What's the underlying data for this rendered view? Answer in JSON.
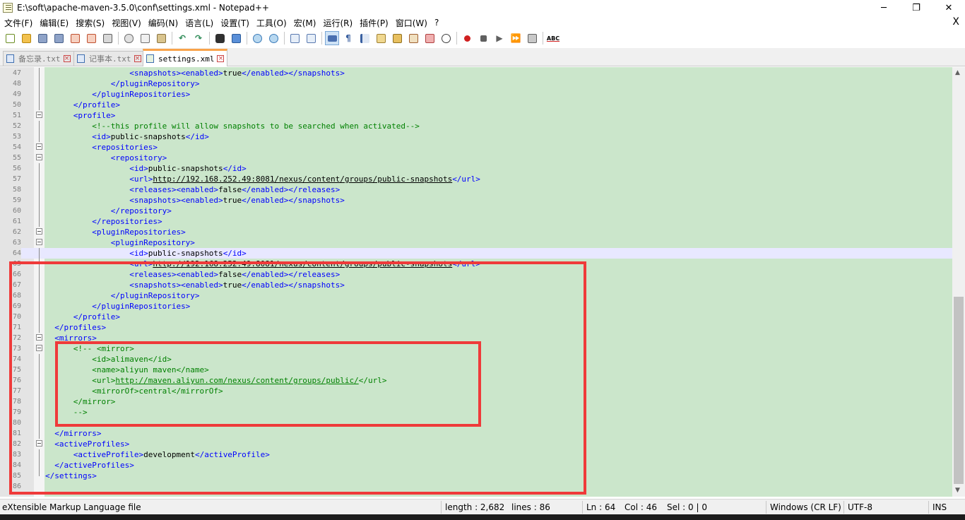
{
  "window": {
    "title": "E:\\soft\\apache-maven-3.5.0\\conf\\settings.xml - Notepad++",
    "minimize": "─",
    "restore": "❐",
    "close": "✕"
  },
  "menu": {
    "items": [
      "文件(F)",
      "编辑(E)",
      "搜索(S)",
      "视图(V)",
      "编码(N)",
      "语言(L)",
      "设置(T)",
      "工具(O)",
      "宏(M)",
      "运行(R)",
      "插件(P)",
      "窗口(W)",
      "?"
    ],
    "close_doc": "X"
  },
  "toolbar": {
    "spell_label": "ABC"
  },
  "tabs": [
    {
      "label": "备忘录.txt",
      "active": false
    },
    {
      "label": "记事本.txt",
      "active": false
    },
    {
      "label": "settings.xml",
      "active": true
    }
  ],
  "editor": {
    "current_line": 64,
    "lines": [
      {
        "n": "47",
        "fold": "line",
        "html": "                  <span class=\"tag\">&lt;snapshots&gt;&lt;enabled&gt;</span>true<span class=\"tag\">&lt;/enabled&gt;&lt;/snapshots&gt;</span>"
      },
      {
        "n": "48",
        "fold": "line",
        "html": "              <span class=\"tag\">&lt;/pluginRepository&gt;</span>"
      },
      {
        "n": "49",
        "fold": "line",
        "html": "          <span class=\"tag\">&lt;/pluginRepositories&gt;</span>"
      },
      {
        "n": "50",
        "fold": "line",
        "html": "      <span class=\"tag\">&lt;/profile&gt;</span>"
      },
      {
        "n": "51",
        "fold": "box",
        "html": "      <span class=\"tag\">&lt;profile&gt;</span>"
      },
      {
        "n": "52",
        "fold": "line",
        "html": "          <span class=\"cmt\">&lt;!--this profile will allow snapshots to be searched when activated--&gt;</span>"
      },
      {
        "n": "53",
        "fold": "line",
        "html": "          <span class=\"tag\">&lt;id&gt;</span>public-snapshots<span class=\"tag\">&lt;/id&gt;</span>"
      },
      {
        "n": "54",
        "fold": "box",
        "html": "          <span class=\"tag\">&lt;repositories&gt;</span>"
      },
      {
        "n": "55",
        "fold": "box",
        "html": "              <span class=\"tag\">&lt;repository&gt;</span>"
      },
      {
        "n": "56",
        "fold": "line",
        "html": "                  <span class=\"tag\">&lt;id&gt;</span>public-snapshots<span class=\"tag\">&lt;/id&gt;</span>"
      },
      {
        "n": "57",
        "fold": "line",
        "html": "                  <span class=\"tag\">&lt;url&gt;</span><span class=\"url\">http://192.168.252.49:8081/nexus/content/groups/public-snapshots</span><span class=\"tag\">&lt;/url&gt;</span>"
      },
      {
        "n": "58",
        "fold": "line",
        "html": "                  <span class=\"tag\">&lt;releases&gt;&lt;enabled&gt;</span>false<span class=\"tag\">&lt;/enabled&gt;&lt;/releases&gt;</span>"
      },
      {
        "n": "59",
        "fold": "line",
        "html": "                  <span class=\"tag\">&lt;snapshots&gt;&lt;enabled&gt;</span>true<span class=\"tag\">&lt;/enabled&gt;&lt;/snapshots&gt;</span>"
      },
      {
        "n": "60",
        "fold": "line",
        "html": "              <span class=\"tag\">&lt;/repository&gt;</span>"
      },
      {
        "n": "61",
        "fold": "line",
        "html": "          <span class=\"tag\">&lt;/repositories&gt;</span>"
      },
      {
        "n": "62",
        "fold": "box",
        "html": "          <span class=\"tag\">&lt;pluginRepositories&gt;</span>"
      },
      {
        "n": "63",
        "fold": "box",
        "html": "              <span class=\"tag\">&lt;pluginRepository&gt;</span>"
      },
      {
        "n": "64",
        "fold": "line",
        "html": "                  <span class=\"tag\">&lt;id&gt;</span>public-snapshots<span class=\"tag\">&lt;/id&gt;</span>"
      },
      {
        "n": "65",
        "fold": "line",
        "html": "                  <span class=\"tag\">&lt;url&gt;</span><span class=\"url\">http://192.168.252.49:8081/nexus/content/groups/public-snapshots</span><span class=\"tag\">&lt;/url&gt;</span>"
      },
      {
        "n": "66",
        "fold": "line",
        "html": "                  <span class=\"tag\">&lt;releases&gt;&lt;enabled&gt;</span>false<span class=\"tag\">&lt;/enabled&gt;&lt;/releases&gt;</span>"
      },
      {
        "n": "67",
        "fold": "line",
        "html": "                  <span class=\"tag\">&lt;snapshots&gt;&lt;enabled&gt;</span>true<span class=\"tag\">&lt;/enabled&gt;&lt;/snapshots&gt;</span>"
      },
      {
        "n": "68",
        "fold": "line",
        "html": "              <span class=\"tag\">&lt;/pluginRepository&gt;</span>"
      },
      {
        "n": "69",
        "fold": "line",
        "html": "          <span class=\"tag\">&lt;/pluginRepositories&gt;</span>"
      },
      {
        "n": "70",
        "fold": "line",
        "html": "      <span class=\"tag\">&lt;/profile&gt;</span>"
      },
      {
        "n": "71",
        "fold": "line",
        "html": "  <span class=\"tag\">&lt;/profiles&gt;</span>"
      },
      {
        "n": "72",
        "fold": "box",
        "html": "  <span class=\"tag\">&lt;mirrors&gt;</span>"
      },
      {
        "n": "73",
        "fold": "box",
        "html": "      <span class=\"cmt\">&lt;!-- &lt;mirror&gt;</span>"
      },
      {
        "n": "74",
        "fold": "line",
        "html": "          <span class=\"cmt\">&lt;id&gt;alimaven&lt;/id&gt;</span>"
      },
      {
        "n": "75",
        "fold": "line",
        "html": "          <span class=\"cmt\">&lt;name&gt;aliyun maven&lt;/name&gt;</span>"
      },
      {
        "n": "76",
        "fold": "line",
        "html": "          <span class=\"cmt\">&lt;url&gt;</span><span class=\"url2\">http://maven.aliyun.com/nexus/content/groups/public/</span><span class=\"cmt\">&lt;/url&gt;</span>"
      },
      {
        "n": "77",
        "fold": "line",
        "html": "          <span class=\"cmt\">&lt;mirrorOf&gt;central&lt;/mirrorOf&gt;</span>"
      },
      {
        "n": "78",
        "fold": "line",
        "html": "      <span class=\"cmt\">&lt;/mirror&gt;</span>"
      },
      {
        "n": "79",
        "fold": "line",
        "html": "      <span class=\"cmt\">--&gt;</span>"
      },
      {
        "n": "80",
        "fold": "line",
        "html": ""
      },
      {
        "n": "81",
        "fold": "line",
        "html": "  <span class=\"tag\">&lt;/mirrors&gt;</span>"
      },
      {
        "n": "82",
        "fold": "box",
        "html": "  <span class=\"tag\">&lt;activeProfiles&gt;</span>"
      },
      {
        "n": "83",
        "fold": "line",
        "html": "      <span class=\"tag\">&lt;activeProfile&gt;</span>development<span class=\"tag\">&lt;/activeProfile&gt;</span>"
      },
      {
        "n": "84",
        "fold": "line",
        "html": "  <span class=\"tag\">&lt;/activeProfiles&gt;</span>"
      },
      {
        "n": "85",
        "fold": "end",
        "html": "<span class=\"tag\">&lt;/settings&gt;</span>"
      },
      {
        "n": "86",
        "fold": "none",
        "html": ""
      }
    ]
  },
  "status": {
    "file_type": "eXtensible Markup Language file",
    "length": "length : 2,682",
    "lines": "lines : 86",
    "ln": "Ln : 64",
    "col": "Col : 46",
    "sel": "Sel : 0 | 0",
    "eol": "Windows (CR LF)",
    "encoding": "UTF-8",
    "mode": "INS"
  },
  "colors": {
    "editor_bg": "#cbe6cb",
    "tag": "#0000ff",
    "comment": "#008000",
    "annotation": "#ef3a3a",
    "active_tab_accent": "#f9a34a"
  }
}
